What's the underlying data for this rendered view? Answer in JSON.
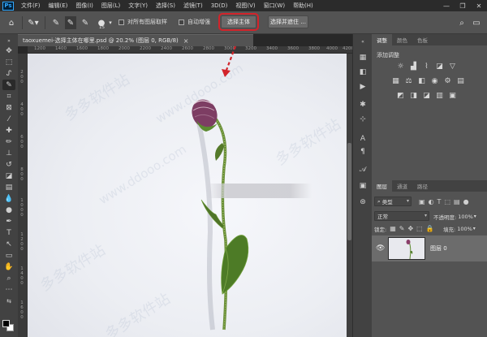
{
  "app": {
    "logo": "Ps"
  },
  "menubar": {
    "items": [
      "文件(F)",
      "编辑(E)",
      "图像(I)",
      "图层(L)",
      "文字(Y)",
      "选择(S)",
      "滤镜(T)",
      "3D(D)",
      "视图(V)",
      "窗口(W)",
      "帮助(H)"
    ],
    "window_controls": [
      "—",
      "❐",
      "✕"
    ]
  },
  "options": {
    "brush_size": "15",
    "sample_all_layers": "对所有图层取样",
    "auto_enhance": "自动增强",
    "select_subject": "选择主体",
    "select_and_mask": "选择并遮住 ..."
  },
  "document": {
    "tab_title": "taoxuemei-选择主体在哪里.psd @ 20.2% (图层 0, RGB/8)",
    "tab_close": "×",
    "ruler_top": [
      "1200",
      "1400",
      "1600",
      "1800",
      "2000",
      "2200",
      "2400",
      "2600",
      "2800",
      "3000",
      "3200",
      "3400",
      "3600",
      "3800",
      "4000",
      "4200"
    ],
    "ruler_left": [
      "2",
      "0",
      "0",
      "4",
      "0",
      "0",
      "6",
      "0",
      "0",
      "8",
      "0",
      "0",
      "1",
      "0",
      "0",
      "0",
      "1",
      "2",
      "0",
      "0",
      "1",
      "4",
      "0",
      "0",
      "1",
      "6",
      "0",
      "0",
      "1",
      "8",
      "0",
      "0",
      "2",
      "0",
      "0",
      "0"
    ],
    "watermarks": [
      "多多软件站",
      "www.ddooo.com",
      "多多软件站",
      "www.ddooo.com",
      "多多软件站",
      "多多软件站"
    ]
  },
  "panels": {
    "top_tabs": [
      "调整",
      "颜色",
      "色板"
    ],
    "adjust_title": "添加调整",
    "layers_tabs": [
      "图层",
      "通道",
      "路径"
    ],
    "filter_kind": "类型",
    "blend_mode": "正常",
    "opacity_label": "不透明度:",
    "opacity_value": "100%",
    "lock_label": "锁定:",
    "fill_label": "填充:",
    "fill_value": "100%",
    "layer_name": "图层 0"
  },
  "colors": {
    "highlight": "#d2232a",
    "foreground": "#000000",
    "background": "#ffffff"
  }
}
